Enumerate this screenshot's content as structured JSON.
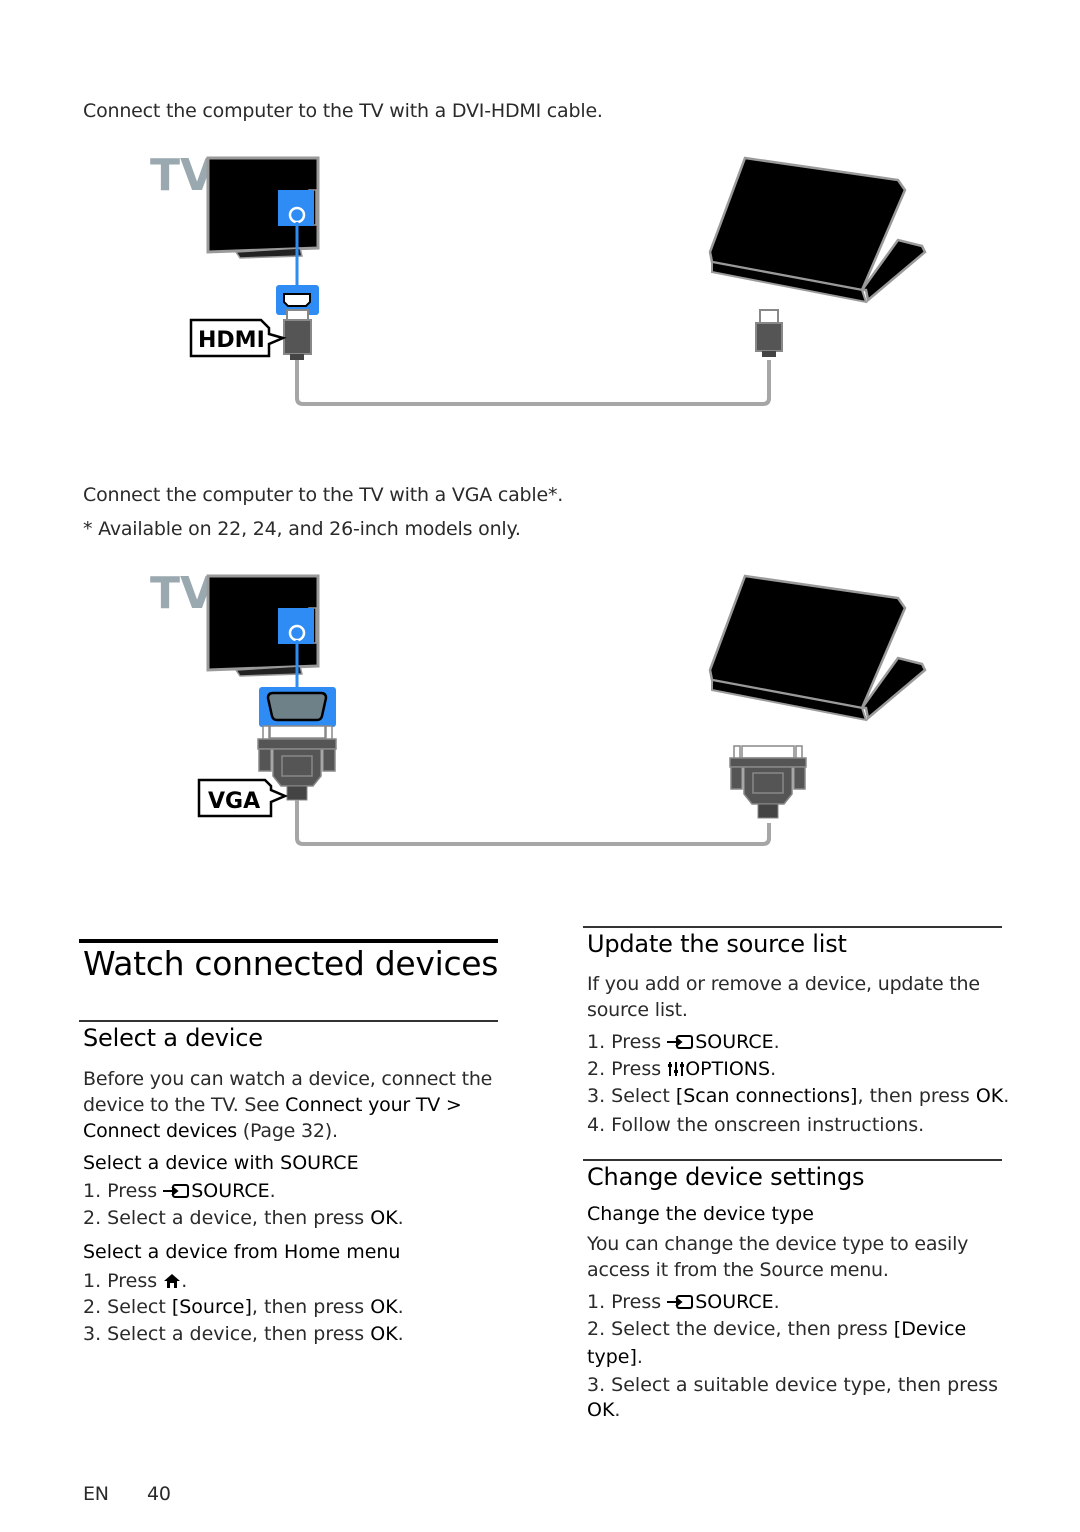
{
  "diagram_hdmi": {
    "caption": "Connect the computer to the TV with a DVI-HDMI cable.",
    "tv_label": "TV",
    "connector_label": "HDMI"
  },
  "diagram_vga": {
    "caption": "Connect the computer to the TV with a VGA cable*.",
    "footnote": "* Available on 22, 24, and 26-inch models only.",
    "tv_label": "TV",
    "connector_label": "VGA"
  },
  "colors": {
    "accent_blue": "#2f8cf5",
    "cable_gray": "#a6a6a6",
    "connector_dark": "#4a4a4a"
  },
  "watch": {
    "title": "Watch connected devices",
    "select_device": {
      "heading": "Select a device",
      "intro_1": "Before you can watch a device, connect the",
      "intro_2": "device to the TV. See ",
      "link_1": "Connect your TV >",
      "link_2": "Connect devices",
      "page_ref": " (Page 32).",
      "with_source": {
        "heading": "Select a device with SOURCE",
        "step1_prefix": "1. Press ",
        "step1_key": "SOURCE",
        "step1_suffix": ".",
        "step2_prefix": "2. Select a device, then press ",
        "step2_key": "OK",
        "step2_suffix": "."
      },
      "from_home": {
        "heading": "Select a device from Home menu",
        "step1_prefix": "1. Press ",
        "step1_suffix": ".",
        "step2_prefix": "2. Select ",
        "step2_option": "[Source]",
        "step2_mid": ", then press ",
        "step2_key": "OK",
        "step2_suffix": ".",
        "step3_prefix": "3. Select a device, then press ",
        "step3_key": "OK",
        "step3_suffix": "."
      }
    }
  },
  "update_source": {
    "heading": "Update the source list",
    "intro_1": "If you add or remove a device, update the",
    "intro_2": "source list.",
    "step1_prefix": "1. Press ",
    "step1_key": "SOURCE",
    "step1_suffix": ".",
    "step2_prefix": "2. Press ",
    "step2_key": "OPTIONS",
    "step2_suffix": ".",
    "step3_prefix": "3. Select ",
    "step3_option": "[Scan connections]",
    "step3_mid": ", then press ",
    "step3_key": "OK",
    "step3_suffix": ".",
    "step4": "4. Follow the onscreen instructions."
  },
  "change_settings": {
    "heading": "Change device settings",
    "subheading": "Change the device type",
    "intro_1": "You can change the device type to easily",
    "intro_2": "access it from the Source menu.",
    "step1_prefix": "1. Press ",
    "step1_key": "SOURCE",
    "step1_suffix": ".",
    "step2_prefix": "2. Select the device, then press ",
    "step2_option_a": "[Device",
    "step2_option_b": "type]",
    "step2_suffix": ".",
    "step3_prefix": "3. Select a suitable device type, then press",
    "step3_key": "OK",
    "step3_suffix": "."
  },
  "footer": {
    "language": "EN",
    "page_number": "40"
  }
}
